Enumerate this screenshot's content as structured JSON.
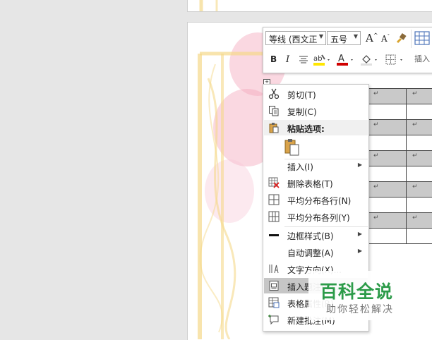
{
  "toolbar": {
    "font_name": "等线 (西文正",
    "font_size": "五号"
  },
  "table": {
    "return_mark": "↵"
  },
  "menu": {
    "items": [
      {
        "label": "剪切(T)",
        "icon": "scissors-icon"
      },
      {
        "label": "复制(C)",
        "icon": "copy-icon"
      },
      {
        "label": "粘贴选项:",
        "icon": "clipboard-icon"
      },
      {
        "label": "插入(I)",
        "icon": "",
        "submenu": true
      },
      {
        "label": "删除表格(T)",
        "icon": "delete-table-icon"
      },
      {
        "label": "平均分布各行(N)",
        "icon": "distribute-rows-icon"
      },
      {
        "label": "平均分布各列(Y)",
        "icon": "distribute-columns-icon"
      },
      {
        "label": "边框样式(B)",
        "icon": "border-style-icon",
        "submenu": true
      },
      {
        "label": "自动调整(A)",
        "icon": "",
        "submenu": true
      },
      {
        "label": "文字方向(X)...",
        "icon": "text-direction-icon"
      },
      {
        "label": "插入题注(C)...",
        "icon": "insert-caption-icon"
      },
      {
        "label": "表格属性(R)...",
        "icon": "table-properties-icon"
      },
      {
        "label": "新建批注(M)",
        "icon": "new-comment-icon"
      }
    ]
  },
  "watermark": {
    "title": "百科全说",
    "subtitle": "助你轻松解决"
  },
  "colors": {
    "highlight": "#ffe600",
    "font_color": "#d00000",
    "watermark_green": "#2c9b49"
  }
}
